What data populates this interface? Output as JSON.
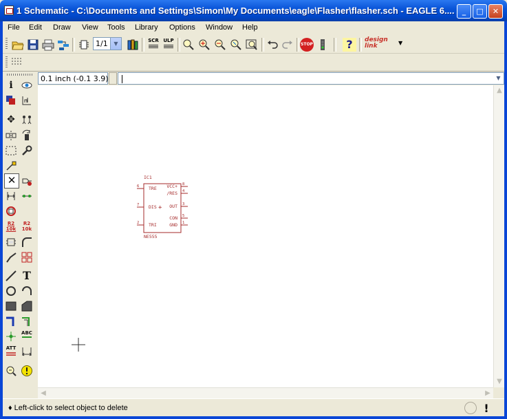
{
  "window": {
    "title": "1 Schematic - C:\\Documents and Settings\\Simon\\My Documents\\eagle\\Flasher\\flasher.sch - EAGLE 6...."
  },
  "menu": [
    "File",
    "Edit",
    "Draw",
    "View",
    "Tools",
    "Library",
    "Options",
    "Window",
    "Help"
  ],
  "toolbar": {
    "sheet_select": "1/1",
    "scr_label": "SCR",
    "ulp_label": "ULP",
    "stop_label": "STOP",
    "help_label": "?",
    "designlink_label": "design link"
  },
  "coords": {
    "grid_text": "0.1 inch (-0.1 3.9)"
  },
  "command": {
    "value": ""
  },
  "schematic": {
    "part_name": "IC1",
    "part_value": "NE555",
    "pins_left": [
      {
        "num": "6",
        "name": "TRE"
      },
      {
        "num": "7",
        "name": "DIS"
      },
      {
        "num": "2",
        "name": "TRI"
      }
    ],
    "pins_right": [
      {
        "num": "8",
        "name": "VCC+"
      },
      {
        "num": "4",
        "name": "/RES"
      },
      {
        "num": "3",
        "name": "OUT"
      },
      {
        "num": "5",
        "name": "CON"
      },
      {
        "num": "1",
        "name": "GND"
      }
    ],
    "color": "#a52a2a"
  },
  "toolbox_labels": {
    "abc": "ABC",
    "att": "ATT"
  },
  "status": {
    "message": "♦ Left-click to select object to delete"
  }
}
